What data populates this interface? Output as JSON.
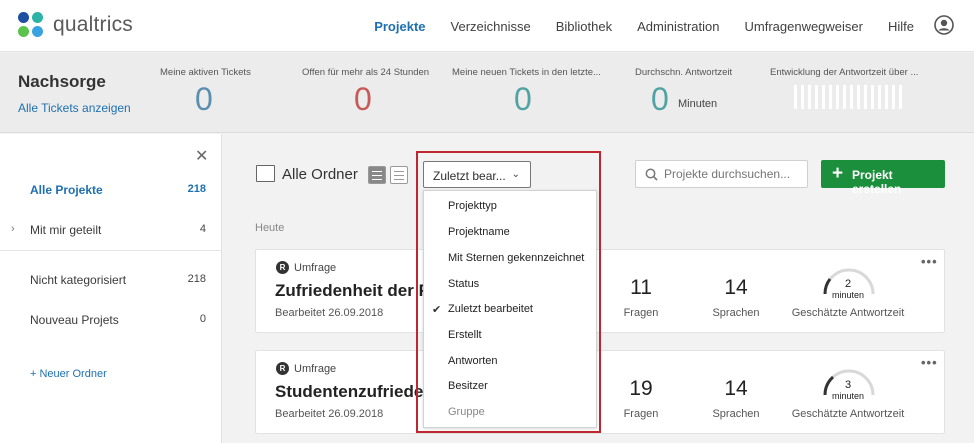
{
  "app": {
    "brand": "qualtrics",
    "logo_dot_colors": [
      "#1e4fa3",
      "#2db2a6",
      "#5bc24c",
      "#3aa2e0"
    ]
  },
  "nav": {
    "items": [
      {
        "label": "Projekte",
        "active": true
      },
      {
        "label": "Verzeichnisse"
      },
      {
        "label": "Bibliothek"
      },
      {
        "label": "Administration"
      },
      {
        "label": "Umfragenwegweiser"
      },
      {
        "label": "Hilfe"
      }
    ],
    "user_icon": "user-circle-icon"
  },
  "stats": {
    "title": "Nachsorge",
    "link": "Alle Tickets anzeigen",
    "items": [
      {
        "label": "Meine aktiven Tickets",
        "value": "0",
        "color": "#5b8fb0"
      },
      {
        "label": "Offen für mehr als 24 Stunden",
        "value": "0",
        "color": "#c75959"
      },
      {
        "label": "Meine neuen Tickets in den letzte...",
        "value": "0",
        "color": "#51a3a3"
      },
      {
        "label": "Durchschn. Antwortzeit",
        "value": "0",
        "unit": "Minuten",
        "color": "#51a3a3"
      },
      {
        "label": "Entwicklung der Antwortzeit über ..."
      }
    ]
  },
  "sidebar": {
    "close_icon": "close-icon",
    "items": [
      {
        "label": "Alle Projekte",
        "count": "218",
        "active": true
      },
      {
        "label": "Mit mir geteilt",
        "count": "4",
        "expandable": true
      },
      {
        "label": "Nicht kategorisiert",
        "count": "218"
      },
      {
        "label": "Nouveau Projets",
        "count": "0"
      }
    ],
    "new_folder": "+ Neuer Ordner"
  },
  "toolbar": {
    "folder_title": "Alle Ordner",
    "sort_selected": "Zuletzt bear...",
    "search_placeholder": "Projekte durchsuchen...",
    "create_label": "Projekt erstellen",
    "create_color": "#1c8f3c"
  },
  "section_label": "Heute",
  "sort_menu": {
    "items": [
      {
        "label": "Projekttyp"
      },
      {
        "label": "Projektname"
      },
      {
        "label": "Mit Sternen gekennzeichnet"
      },
      {
        "label": "Status"
      },
      {
        "label": "Zuletzt bearbeitet",
        "checked": true
      },
      {
        "label": "Erstellt"
      },
      {
        "label": "Antworten"
      },
      {
        "label": "Besitzer"
      },
      {
        "label": "Gruppe",
        "disabled": true
      }
    ]
  },
  "projects": [
    {
      "type": "Umfrage",
      "type_icon": "R",
      "name": "Zufriedenheit der Fa",
      "edited": "Bearbeitet 26.09.2018",
      "questions": "11",
      "questions_label": "Fragen",
      "languages": "14",
      "languages_label": "Sprachen",
      "duration": "2",
      "duration_unit": "minuten",
      "duration_label": "Geschätzte Antwortzeit"
    },
    {
      "type": "Umfrage",
      "type_icon": "R",
      "name": "Studentenzufrieden",
      "edited": "Bearbeitet 26.09.2018",
      "questions": "19",
      "questions_label": "Fragen",
      "languages": "14",
      "languages_label": "Sprachen",
      "duration": "3",
      "duration_unit": "minuten",
      "duration_label": "Geschätzte Antwortzeit"
    }
  ],
  "accent": "#1e70b0",
  "highlight_color": "#c0262d"
}
